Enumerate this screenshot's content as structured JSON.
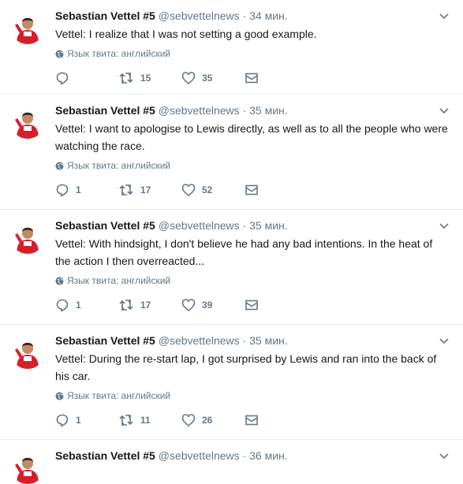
{
  "tweets": [
    {
      "name": "Sebastian Vettel #5",
      "handle": "@sebvettelnews",
      "dot": "·",
      "time": "34 мин.",
      "text": "Vettel: I realize that I was not setting a good example.",
      "lang": "Язык твита: английский",
      "replies": "",
      "retweets": "15",
      "likes": "35"
    },
    {
      "name": "Sebastian Vettel #5",
      "handle": "@sebvettelnews",
      "dot": "·",
      "time": "35 мин.",
      "text": "Vettel: I want to apologise to Lewis directly, as well as to all the people who were watching the race.",
      "lang": "Язык твита: английский",
      "replies": "1",
      "retweets": "17",
      "likes": "52"
    },
    {
      "name": "Sebastian Vettel #5",
      "handle": "@sebvettelnews",
      "dot": "·",
      "time": "35 мин.",
      "text": "Vettel: With hindsight, I don't believe he had any bad intentions. In the heat of the action I then overreacted...",
      "lang": "Язык твита: английский",
      "replies": "1",
      "retweets": "17",
      "likes": "39"
    },
    {
      "name": "Sebastian Vettel #5",
      "handle": "@sebvettelnews",
      "dot": "·",
      "time": "35 мин.",
      "text": "Vettel: During the re-start lap, I got surprised by Lewis and ran into the back of his car.",
      "lang": "Язык твита: английский",
      "replies": "1",
      "retweets": "11",
      "likes": "26"
    },
    {
      "name": "Sebastian Vettel #5",
      "handle": "@sebvettelnews",
      "dot": "·",
      "time": "36 мин."
    }
  ],
  "icons": {
    "reply": "reply-icon",
    "retweet": "retweet-icon",
    "like": "heart-icon",
    "dm": "envelope-icon",
    "globe": "globe-icon",
    "caret": "chevron-down-icon"
  },
  "colors": {
    "icon": "#657786",
    "avatar_red": "#d5202b"
  }
}
